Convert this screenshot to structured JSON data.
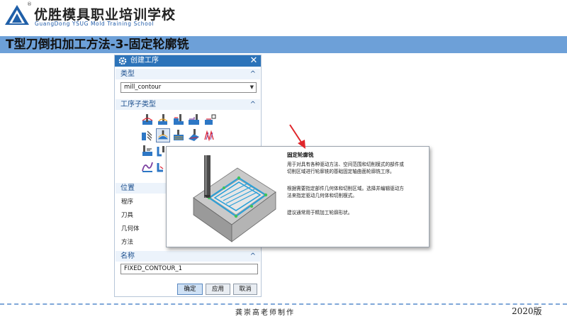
{
  "header": {
    "registered_mark": "®",
    "school_cn": "优胜模具职业培训学校",
    "school_en": "GuangDong YSUG Mold Training School",
    "slide_title": "T型刀倒扣加工方法-3-固定轮廓铣"
  },
  "dialog": {
    "title": "创建工序",
    "close_glyph": "✕",
    "type_section": {
      "label": "类型",
      "selected_value": "mill_contour"
    },
    "subtype_section": {
      "label": "工序子类型",
      "selected_icon": "fixed-contour-op-icon"
    },
    "location_section": {
      "label": "位置",
      "fields": [
        "程序",
        "刀具",
        "几何体",
        "方法"
      ]
    },
    "name_section": {
      "label": "名称",
      "value": "FIXED_CONTOUR_1"
    },
    "buttons": {
      "ok": "确定",
      "apply": "应用",
      "cancel": "取消"
    }
  },
  "tooltip": {
    "title": "固定轮廓铣",
    "paragraphs": [
      [
        "用于对具有各种驱动方法、空间范围和切削模式的部件或",
        "切削区域进行轮廓铣的基础固定轴曲面轮廓铣工序。"
      ],
      [
        "根据需要指定部件几何体和切削区域。选择并编辑驱动方",
        "法来指定驱动几何体和切削模式。"
      ],
      [
        "建议通常用于精加工轮廓形状。"
      ]
    ]
  },
  "footer": {
    "author": "龚崇高老师制作",
    "edition": "2020版"
  },
  "colors": {
    "title_bar": "#6da0d8",
    "dialog_titlebar": "#2c73b9",
    "section_text": "#1c4f8e",
    "arrow": "#e0262b"
  }
}
